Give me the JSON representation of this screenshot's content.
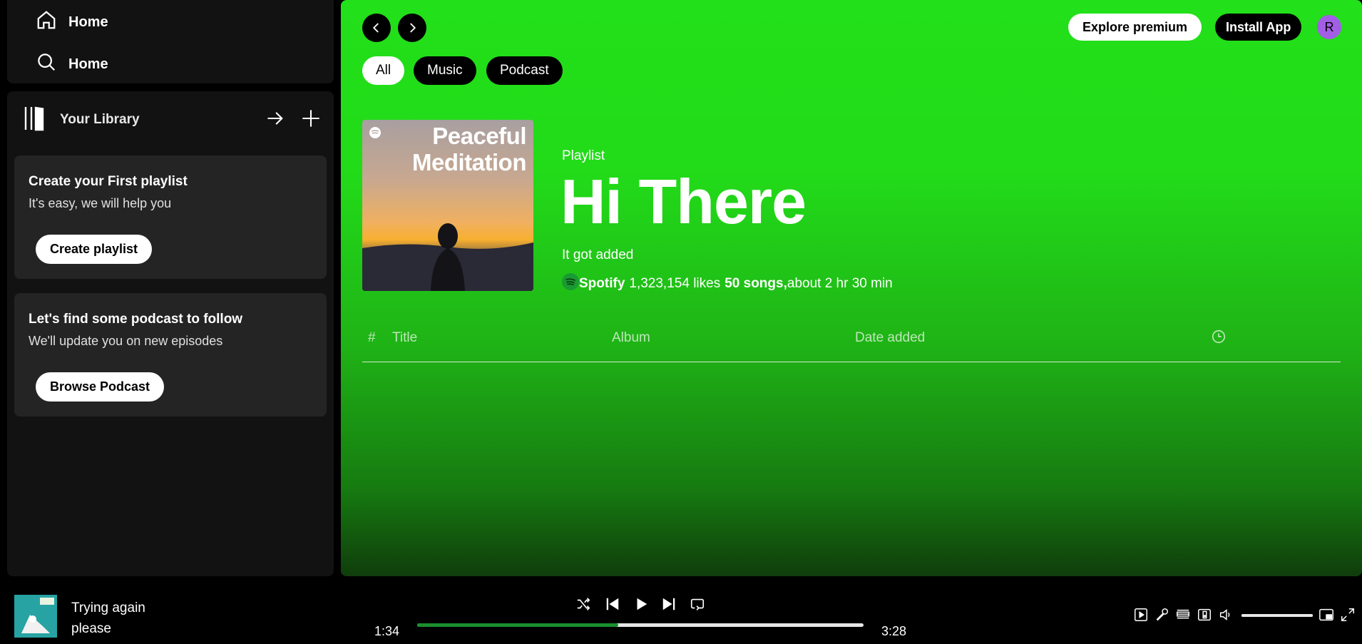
{
  "sidebar": {
    "nav": [
      {
        "label": "Home",
        "icon": "home-icon"
      },
      {
        "label": "Home",
        "icon": "search-icon"
      }
    ],
    "library": {
      "title": "Your Library",
      "cards": [
        {
          "title": "Create your First playlist",
          "subtitle": "It's easy, we will help you",
          "button": "Create playlist"
        },
        {
          "title": "Let's find some podcast to follow",
          "subtitle": "We'll update you on new episodes",
          "button": "Browse Podcast"
        }
      ]
    }
  },
  "header": {
    "explore_premium": "Explore premium",
    "install_app": "Install App",
    "avatar_initial": "R"
  },
  "filters": [
    "All",
    "Music",
    "Podcast"
  ],
  "playlist": {
    "cover_text_line1": "Peaceful",
    "cover_text_line2": "Meditation",
    "type": "Playlist",
    "title": "Hi There",
    "description": "It got added",
    "owner": "Spotify",
    "likes": "1,323,154 likes",
    "songs": "50 songs,",
    "duration": "about 2 hr 30 min"
  },
  "table": {
    "columns": [
      "#",
      "Title",
      "Album",
      "Date added"
    ],
    "duration_icon": "clock-icon"
  },
  "player": {
    "track_line1": "Trying again",
    "track_line2": "please",
    "current_time": "1:34",
    "total_time": "3:28",
    "progress": 0.45,
    "volume": 1.0
  },
  "colors": {
    "accent": "#1db954",
    "main_bg_top": "#22e019",
    "avatar": "#a35ee6"
  }
}
